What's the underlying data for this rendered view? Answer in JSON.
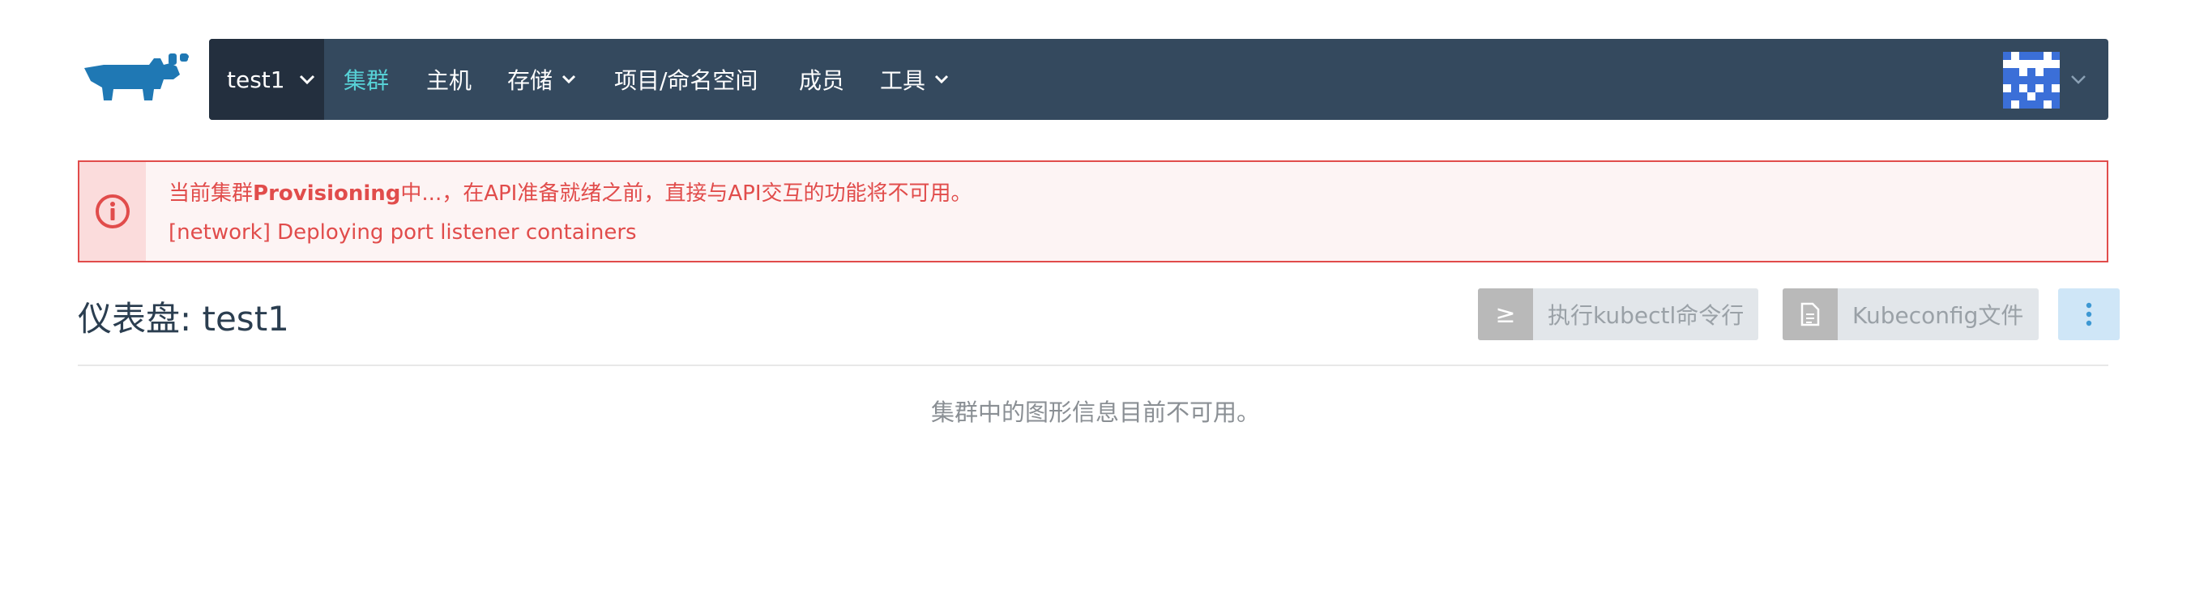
{
  "nav": {
    "cluster_name": "test1",
    "items": [
      {
        "label": "集群",
        "active": true
      },
      {
        "label": "主机",
        "active": false
      },
      {
        "label": "存储",
        "dropdown": true
      },
      {
        "label": "项目/命名空间",
        "active": false
      },
      {
        "label": "成员",
        "active": false
      },
      {
        "label": "工具",
        "dropdown": true
      }
    ]
  },
  "alert": {
    "line1_prefix": "当前集群",
    "line1_bold": "Provisioning",
    "line1_suffix": "中...，在API准备就绪之前，直接与API交互的功能将不可用。",
    "line2": "[network] Deploying port listener containers"
  },
  "dashboard": {
    "title": "仪表盘: test1",
    "kubectl_icon": "≥",
    "kubectl_label": "执行kubectl命令行",
    "kubeconfig_label": "Kubeconfig文件",
    "empty_message": "集群中的图形信息目前不可用。"
  },
  "colors": {
    "nav_bg": "#34495e",
    "nav_cluster_bg": "#232f3e",
    "nav_active": "#57d1d6",
    "alert_red": "#e14c4b",
    "alert_bg": "#fdf4f4",
    "brand_blue": "#1f78b4"
  },
  "icons": {
    "logo": "rancher-logo",
    "alert": "info-circle-icon",
    "user": "identicon-avatar",
    "file": "file-icon",
    "more": "vertical-dots-icon"
  }
}
